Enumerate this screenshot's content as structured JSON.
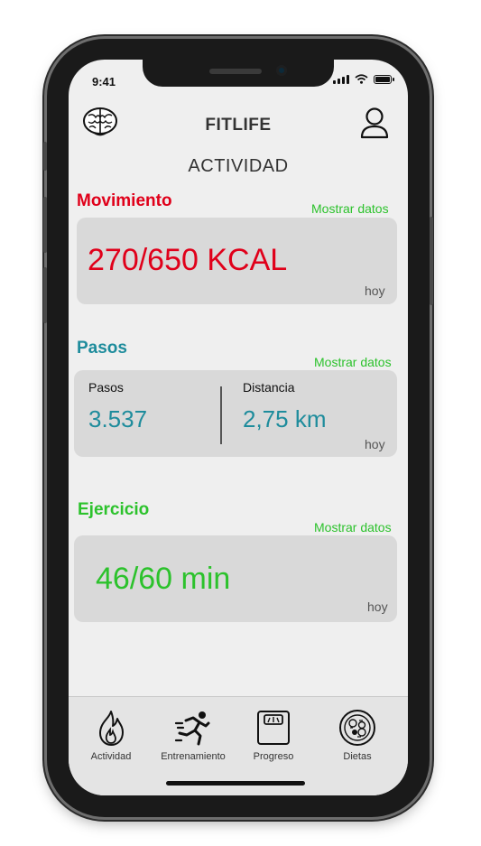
{
  "status_bar": {
    "time": "9:41"
  },
  "header": {
    "app_name": "FITLIFE",
    "logo_icon": "brain-logo-icon",
    "profile_icon": "user-profile-icon"
  },
  "section_title": "ACTIVIDAD",
  "movimiento": {
    "title": "Movimiento",
    "link": "Mostrar datos",
    "value": "270/650 KCAL",
    "period": "hoy",
    "color": "#e0001a"
  },
  "pasos": {
    "title": "Pasos",
    "link": "Mostrar datos",
    "steps_label": "Pasos",
    "steps_value": "3.537",
    "distance_label": "Distancia",
    "distance_value": "2,75 km",
    "period": "hoy",
    "color": "#1e8c9c"
  },
  "ejercicio": {
    "title": "Ejercicio",
    "link": "Mostrar datos",
    "value": "46/60 min",
    "period": "hoy",
    "color": "#2cc22c"
  },
  "tabbar": {
    "tabs": [
      {
        "label": "Actividad",
        "icon": "flame-icon"
      },
      {
        "label": "Entrenamiento",
        "icon": "runner-icon"
      },
      {
        "label": "Progreso",
        "icon": "scale-icon"
      },
      {
        "label": "Dietas",
        "icon": "food-plate-icon"
      }
    ]
  },
  "accent_link_color": "#2cc22c"
}
